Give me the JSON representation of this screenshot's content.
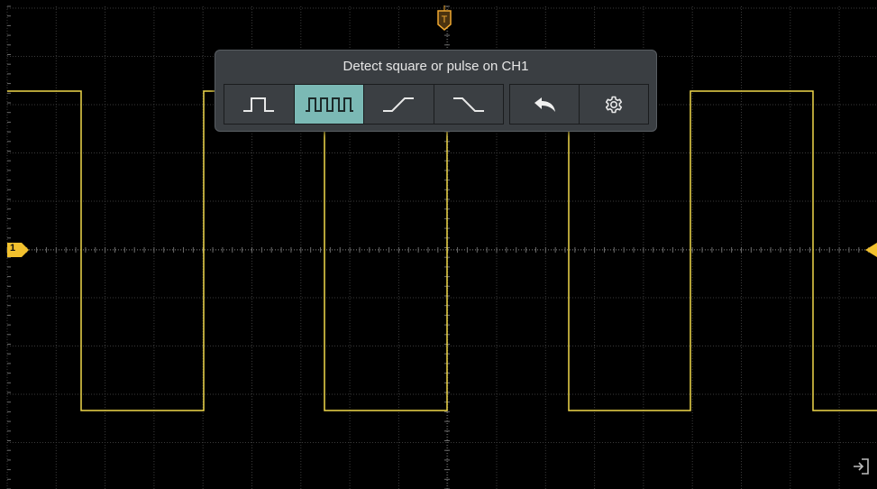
{
  "popup": {
    "title": "Detect square or pulse on CH1",
    "buttons": [
      {
        "icon": "single-pulse-icon",
        "selected": false
      },
      {
        "icon": "pulse-train-icon",
        "selected": true
      },
      {
        "icon": "rising-edge-icon",
        "selected": false
      },
      {
        "icon": "falling-edge-icon",
        "selected": false
      },
      {
        "icon": "undo-icon",
        "selected": false
      },
      {
        "icon": "gear-icon",
        "selected": false
      }
    ]
  },
  "markers": {
    "trigger_label": "T",
    "channel_label": "1"
  },
  "colors": {
    "trace": "#f0d84a",
    "grid": "#3a3a3a",
    "axis": "#6a6a6a",
    "marker": "#f2c12e",
    "trigger_marker": "#f0a830",
    "popup_bg": "#3a3e42",
    "selected_button": "#7bb9b5"
  },
  "waveform": {
    "type": "square",
    "levels": [
      "high",
      "low"
    ]
  }
}
